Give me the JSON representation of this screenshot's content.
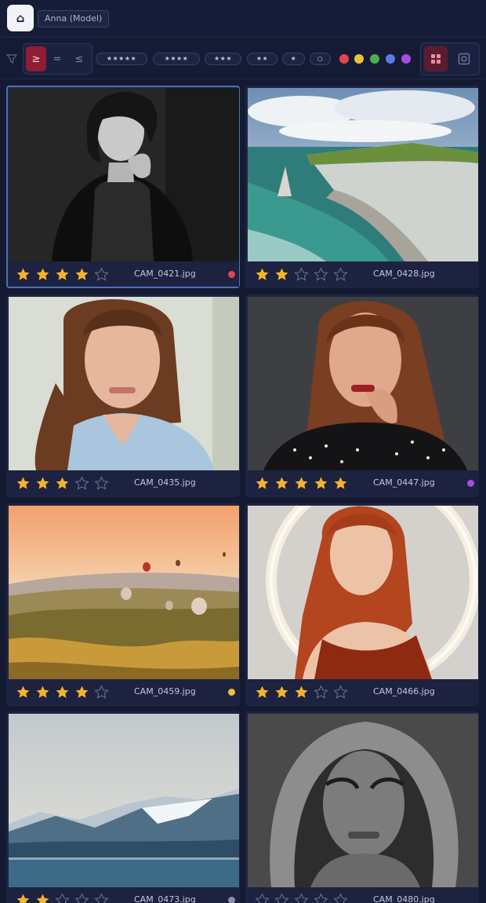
{
  "header": {
    "home_icon": "home-icon",
    "profile_label": "Anna (Model)"
  },
  "toolbar": {
    "filter_icon": "filter-icon",
    "comparison": [
      {
        "label": "≥",
        "active": true
      },
      {
        "label": "=",
        "active": false
      },
      {
        "label": "≤",
        "active": false
      }
    ],
    "rating_filters": [
      "★★★★★",
      "★★★★",
      "★★★",
      "★★",
      "★",
      "○"
    ],
    "color_filters": [
      "#e2474f",
      "#e7c33d",
      "#4cae4c",
      "#5b7be6",
      "#a64de0"
    ],
    "views": [
      {
        "name": "grid-view-icon",
        "active": true
      },
      {
        "name": "single-view-icon",
        "active": false
      }
    ]
  },
  "gallery": {
    "selected_index": 0,
    "photos": [
      {
        "filename": "CAM_0421.jpg",
        "rating": 4,
        "color_label": "#e2474f",
        "subject": "black-and-white portrait of woman with dark hair"
      },
      {
        "filename": "CAM_0428.jpg",
        "rating": 2,
        "color_label": null,
        "subject": "coastal cliffs with sea arch"
      },
      {
        "filename": "CAM_0435.jpg",
        "rating": 3,
        "color_label": null,
        "subject": "portrait of smiling woman in striped shirt"
      },
      {
        "filename": "CAM_0447.jpg",
        "rating": 5,
        "color_label": "#a64de0",
        "subject": "portrait of woman in polka dot blouse"
      },
      {
        "filename": "CAM_0459.jpg",
        "rating": 4,
        "color_label": "#e7c33d",
        "subject": "hot air balloons over valley at sunrise"
      },
      {
        "filename": "CAM_0466.jpg",
        "rating": 3,
        "color_label": null,
        "subject": "red-haired woman in front of ring light"
      },
      {
        "filename": "CAM_0473.jpg",
        "rating": 2,
        "color_label": "#8b8fa8",
        "subject": "mountain lake landscape"
      },
      {
        "filename": "CAM_0480.jpg",
        "rating": 0,
        "color_label": null,
        "subject": "black-and-white portrait of person in hood"
      }
    ]
  }
}
